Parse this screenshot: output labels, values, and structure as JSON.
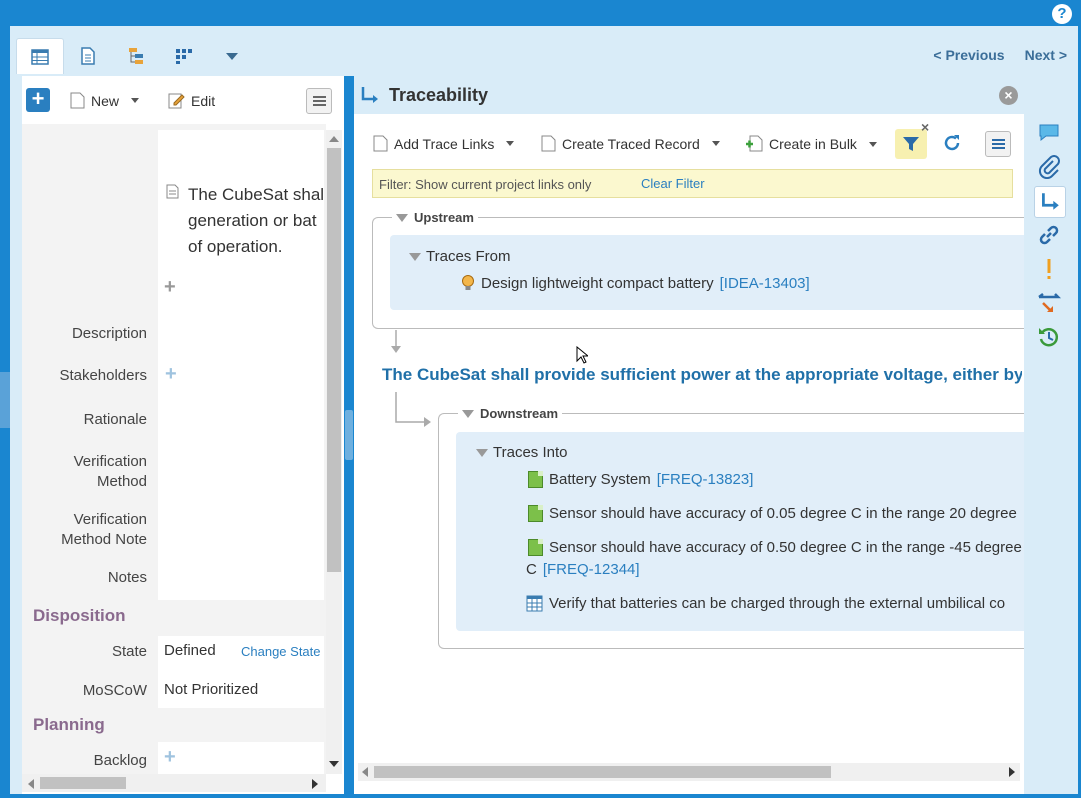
{
  "help": {
    "icon": "help-icon",
    "label": "?"
  },
  "nav": {
    "previous": "< Previous",
    "next": "Next >"
  },
  "left_toolbar": {
    "new_label": "New",
    "edit_label": "Edit"
  },
  "record": {
    "summary_lines": [
      "The CubeSat shal",
      "generation or bat",
      "of operation."
    ],
    "fields": {
      "description": "Description",
      "stakeholders": "Stakeholders",
      "rationale": "Rationale",
      "verification_method": [
        "Verification",
        "Method"
      ],
      "verification_method_note": [
        "Verification",
        "Method Note"
      ],
      "notes": "Notes"
    },
    "disposition": {
      "heading": "Disposition",
      "state_label": "State",
      "state_value": "Defined",
      "change_state": "Change State",
      "moscow_label": "MoSCoW",
      "moscow_value": "Not Prioritized"
    },
    "planning": {
      "heading": "Planning",
      "backlog_label": "Backlog"
    }
  },
  "traceability": {
    "title": "Traceability",
    "toolbar": {
      "add_trace_links": "Add Trace Links",
      "create_traced_record": "Create Traced Record",
      "create_in_bulk": "Create in Bulk"
    },
    "filter": {
      "text": "Filter: Show current project links only",
      "clear": "Clear Filter"
    },
    "upstream": {
      "title": "Upstream",
      "traces_from": "Traces From",
      "items": [
        {
          "text": "Design lightweight compact battery",
          "id": "[IDEA-13403]"
        }
      ]
    },
    "current_requirement": "The CubeSat shall provide sufficient power at the appropriate voltage, either by",
    "downstream": {
      "title": "Downstream",
      "traces_into": "Traces Into",
      "items": [
        {
          "text": "Battery System",
          "id": "[FREQ-13823]"
        },
        {
          "text": "Sensor should have accuracy of 0.05 degree C in the range 20 degree",
          "id": ""
        },
        {
          "text": "Sensor should have accuracy of 0.50 degree C in the range -45 degree",
          "id": ""
        },
        {
          "text": "C",
          "id": "[FREQ-12344]"
        },
        {
          "text": "Verify that batteries can be charged through the external umbilical co",
          "id": ""
        }
      ]
    }
  },
  "colors": {
    "brand": "#1a86d0",
    "panel": "#d9ecf8",
    "link": "#2a7fc0",
    "section": "#8a6a8e"
  }
}
